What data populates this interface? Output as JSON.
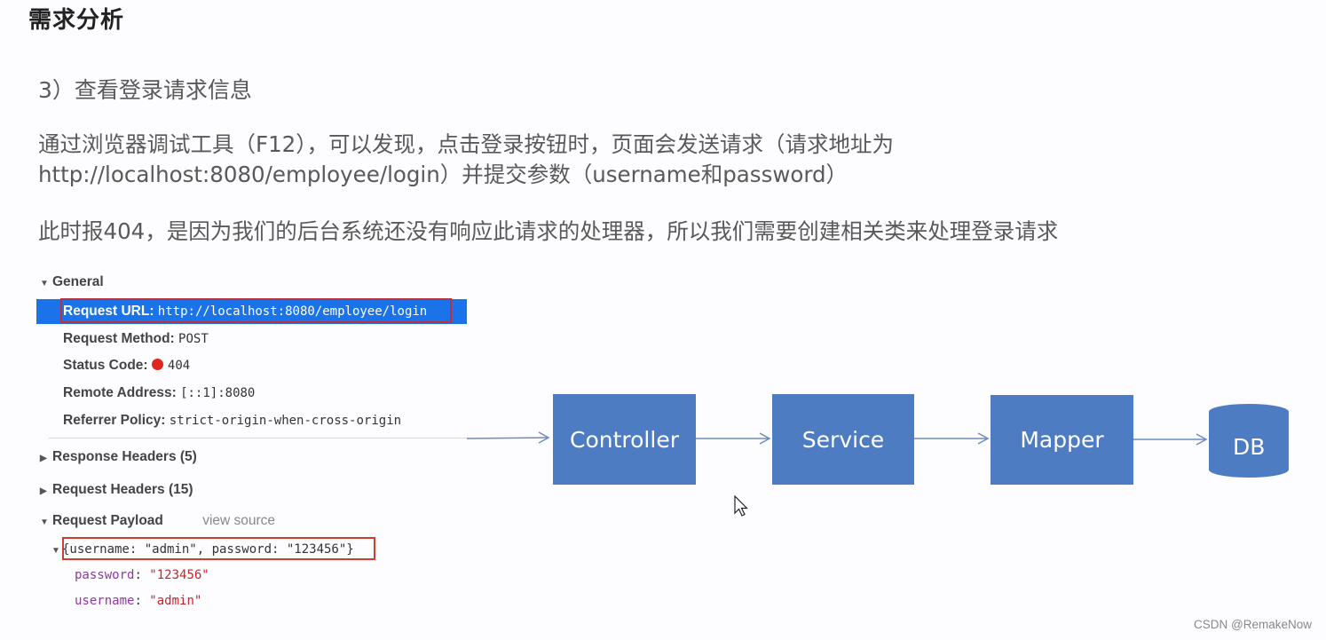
{
  "slide": {
    "title": "需求分析",
    "subtitle": "3）查看登录请求信息",
    "paragraph1_line1": "通过浏览器调试工具（F12），可以发现，点击登录按钮时，页面会发送请求（请求地址为",
    "paragraph1_line2": "http://localhost:8080/employee/login）并提交参数（username和password）",
    "paragraph2": "此时报404，是因为我们的后台系统还没有响应此请求的处理器，所以我们需要创建相关类来处理登录请求"
  },
  "devtools": {
    "general": {
      "header": "General",
      "rows": [
        {
          "label": "Request URL:",
          "value": "http://localhost:8080/employee/login"
        },
        {
          "label": "Request Method:",
          "value": "POST"
        },
        {
          "label": "Status Code:",
          "value": "404",
          "status_icon": "red-dot",
          "status_color": "#e0261a"
        },
        {
          "label": "Remote Address:",
          "value": "[::1]:8080"
        },
        {
          "label": "Referrer Policy:",
          "value": "strict-origin-when-cross-origin"
        }
      ]
    },
    "response_headers": "Response Headers (5)",
    "request_headers": "Request Headers (15)",
    "request_payload": {
      "header": "Request Payload",
      "view_source": "view source",
      "summary": "{username: \"admin\", password: \"123456\"}",
      "fields": [
        {
          "key": "password",
          "value": "\"123456\""
        },
        {
          "key": "username",
          "value": "\"admin\""
        }
      ]
    },
    "highlight_color": "#1a73e8",
    "outline_color": "#c0303a"
  },
  "diagram": {
    "nodes": [
      "Controller",
      "Service",
      "Mapper",
      "DB"
    ],
    "box_color": "#4e7cc3"
  },
  "watermark": "CSDN @RemakeNow"
}
